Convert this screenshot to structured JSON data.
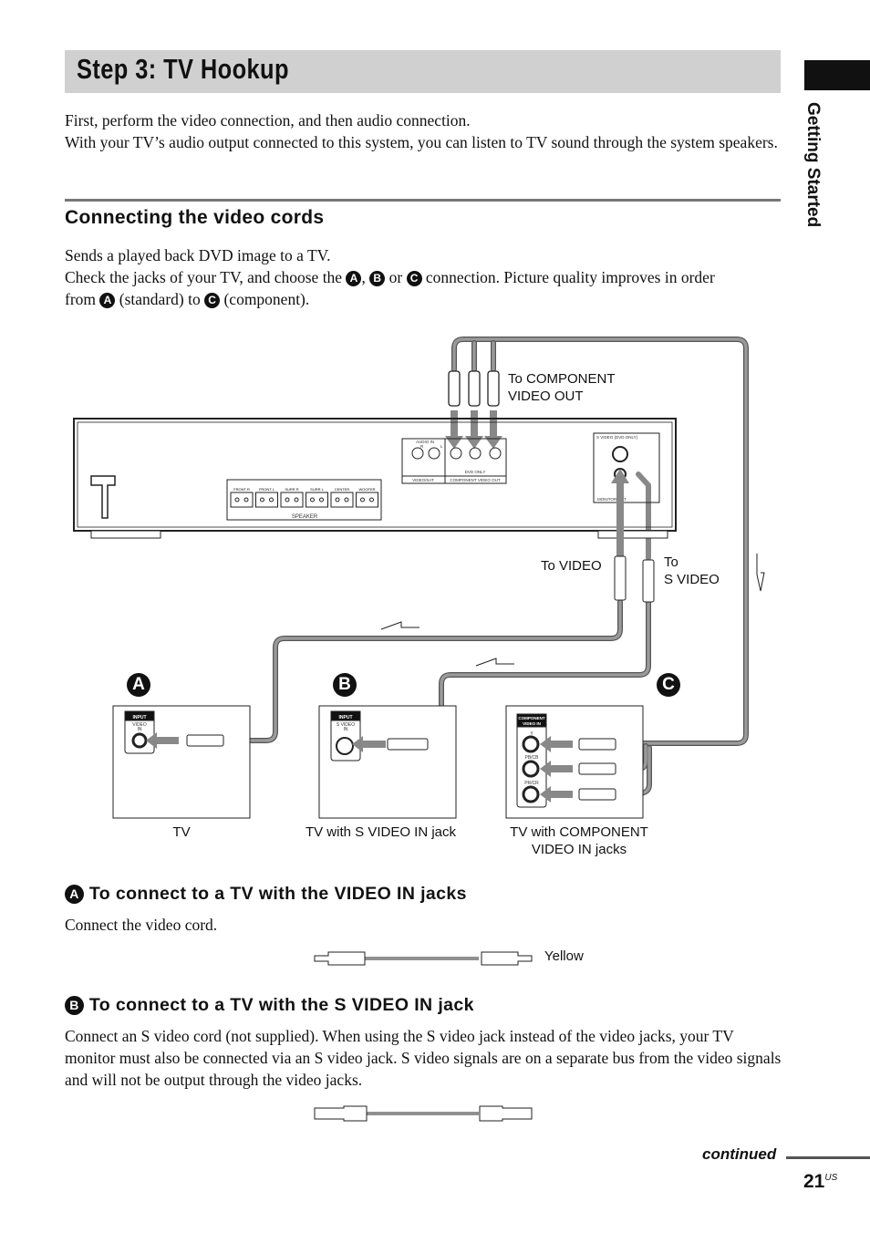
{
  "header": {
    "title": "Step 3: TV Hookup"
  },
  "intro": {
    "line1": "First, perform the video connection, and then audio connection.",
    "line2": "With your TV’s audio output connected to this system, you can listen to TV sound through the system speakers."
  },
  "section": {
    "title": "Connecting the video cords",
    "p1": "Sends a played back DVD image to a TV.",
    "p2_a": "Check the jacks of your TV, and choose the ",
    "p2_b": ", ",
    "p2_c": " or ",
    "p2_d": " connection. Picture quality improves in order",
    "p3_a": "from ",
    "p3_b": " (standard) to ",
    "p3_c": " (component)."
  },
  "markers": {
    "a": "A",
    "b": "B",
    "c": "C"
  },
  "sidebar": {
    "tab_label": "Getting Started"
  },
  "diagram": {
    "to_component": "To COMPONENT\nVIDEO OUT",
    "to_component_1": "To COMPONENT",
    "to_component_2": "VIDEO OUT",
    "to_video": "To VIDEO",
    "to_svideo_1": "To",
    "to_svideo_2": "S VIDEO",
    "tv_a": "TV",
    "tv_b": "TV with S VIDEO IN jack",
    "tv_c_1": "TV with COMPONENT",
    "tv_c_2": "VIDEO IN jacks",
    "speakers": [
      "FRONT R",
      "FRONT L",
      "SURR R",
      "SURR L",
      "CENTER",
      "WOOFER"
    ],
    "speaker_label": "SPEAKER",
    "audio_in": "AUDIO IN",
    "r": "R",
    "l": "L",
    "dvd_only": "DVD ONLY",
    "video_sat": "VIDEO/SAT",
    "component_out": "COMPONENT VIDEO OUT",
    "s_video_dvd_only": "S  VIDEO  (DVD ONLY)",
    "monitor_out": "MONITOR OUT",
    "input": "INPUT",
    "video_in_1": "VIDEO",
    "video_in_2": "IN",
    "s_video_in_1": "S VIDEO",
    "s_video_in_2": "IN",
    "comp_in_1": "COMPONENT",
    "comp_in_2": "VIDEO IN",
    "y": "Y",
    "pb": "PB/CB",
    "pr": "PR/CR"
  },
  "sub_a": {
    "title": "To connect to a TV with the VIDEO IN jacks",
    "body": "Connect the video cord.",
    "cord_label": "Yellow"
  },
  "sub_b": {
    "title": "To connect to a TV with the S VIDEO IN jack",
    "body": "Connect an S video cord (not supplied). When using the S video jack instead of the video jacks, your TV monitor must also be connected via an S video jack. S video signals are on a separate bus from the video signals and will not be output through the video jacks."
  },
  "footer": {
    "continued": "continued",
    "page": "21",
    "page_suffix": "US"
  },
  "colors": {
    "cord_gray": "#8c8c8c",
    "title_bar": "#d0d0d0"
  }
}
